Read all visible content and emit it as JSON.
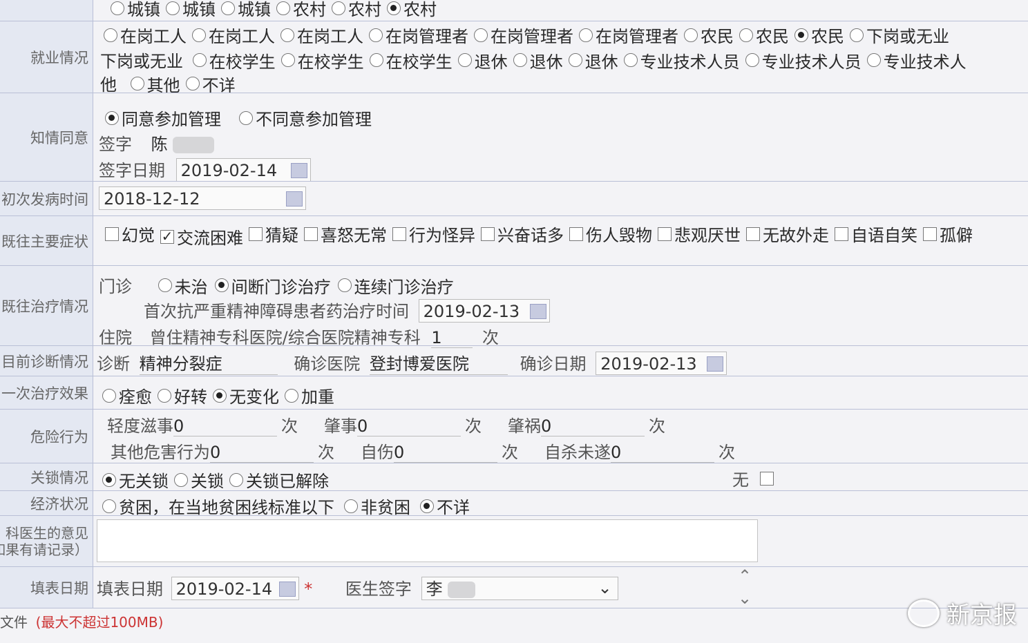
{
  "residence": {
    "options": [
      {
        "label": "城镇",
        "checked": false
      },
      {
        "label": "城镇",
        "checked": false
      },
      {
        "label": "城镇",
        "checked": false
      },
      {
        "label": "农村",
        "checked": false
      },
      {
        "label": "农村",
        "checked": false
      },
      {
        "label": "农村",
        "checked": true
      }
    ]
  },
  "employment": {
    "label": "就业情况",
    "line1": [
      {
        "label": "在岗工人",
        "checked": false
      },
      {
        "label": "在岗工人",
        "checked": false
      },
      {
        "label": "在岗工人",
        "checked": false
      },
      {
        "label": "在岗管理者",
        "checked": false
      },
      {
        "label": "在岗管理者",
        "checked": false
      },
      {
        "label": "在岗管理者",
        "checked": false
      },
      {
        "label": "农民",
        "checked": false
      },
      {
        "label": "农民",
        "checked": false
      },
      {
        "label": "农民",
        "checked": true
      },
      {
        "label": "下岗或无业",
        "checked": false
      }
    ],
    "line2_prefix": "下岗或无业",
    "line2": [
      {
        "label": "在校学生",
        "checked": false
      },
      {
        "label": "在校学生",
        "checked": false
      },
      {
        "label": "在校学生",
        "checked": false
      },
      {
        "label": "退休",
        "checked": false
      },
      {
        "label": "退休",
        "checked": false
      },
      {
        "label": "退休",
        "checked": false
      },
      {
        "label": "专业技术人员",
        "checked": false
      },
      {
        "label": "专业技术人员",
        "checked": false
      },
      {
        "label": "专业技术人",
        "checked": false
      }
    ],
    "line3_prefix": "他",
    "line3": [
      {
        "label": "其他",
        "checked": false
      },
      {
        "label": "不详",
        "checked": false
      }
    ]
  },
  "consent": {
    "label": "知情同意",
    "options": [
      {
        "label": "同意参加管理",
        "checked": true
      },
      {
        "label": "不同意参加管理",
        "checked": false
      }
    ],
    "sign_label": "签字",
    "sign_value": "陈",
    "date_label": "签字日期",
    "date_value": "2019-02-14"
  },
  "onset": {
    "label": "初次发病时间",
    "value": "2018-12-12"
  },
  "symptoms": {
    "label": "既往主要症状",
    "items": [
      {
        "label": "幻觉",
        "checked": false
      },
      {
        "label": "交流困难",
        "checked": true
      },
      {
        "label": "猜疑",
        "checked": false
      },
      {
        "label": "喜怒无常",
        "checked": false
      },
      {
        "label": "行为怪异",
        "checked": false
      },
      {
        "label": "兴奋话多",
        "checked": false
      },
      {
        "label": "伤人毁物",
        "checked": false
      },
      {
        "label": "悲观厌世",
        "checked": false
      },
      {
        "label": "无故外走",
        "checked": false
      },
      {
        "label": "自语自笑",
        "checked": false
      },
      {
        "label": "孤僻",
        "checked": false
      }
    ]
  },
  "treatment": {
    "label": "既往治疗情况",
    "outpatient_label": "门诊",
    "outpatient": [
      {
        "label": "未治",
        "checked": false
      },
      {
        "label": "间断门诊治疗",
        "checked": true
      },
      {
        "label": "连续门诊治疗",
        "checked": false
      }
    ],
    "first_drug_label": "首次抗严重精神障碍患者药治疗时间",
    "first_drug_date": "2019-02-13",
    "inpatient_label": "住院",
    "inpatient_text": "曾住精神专科医院/综合医院精神专科",
    "inpatient_count": "1",
    "times_unit": "次"
  },
  "diagnosis": {
    "label": "目前诊断情况",
    "diag_label": "诊断",
    "diag_value": "精神分裂症",
    "hospital_label": "确诊医院",
    "hospital_value": "登封博爱医院",
    "date_label": "确诊日期",
    "date_value": "2019-02-13"
  },
  "effect": {
    "label": "一次治疗效果",
    "options": [
      {
        "label": "痊愈",
        "checked": false
      },
      {
        "label": "好转",
        "checked": false
      },
      {
        "label": "无变化",
        "checked": true
      },
      {
        "label": "加重",
        "checked": false
      }
    ]
  },
  "danger": {
    "label": "危险行为",
    "items": [
      {
        "label": "轻度滋事",
        "value": "0"
      },
      {
        "label": "肇事",
        "value": "0"
      },
      {
        "label": "肇祸",
        "value": "0"
      },
      {
        "label": "其他危害行为",
        "value": "0"
      },
      {
        "label": "自伤",
        "value": "0"
      },
      {
        "label": "自杀未遂",
        "value": "0"
      }
    ],
    "unit": "次",
    "none_label": "无"
  },
  "lock": {
    "label": "关锁情况",
    "options": [
      {
        "label": "无关锁",
        "checked": true
      },
      {
        "label": "关锁",
        "checked": false
      },
      {
        "label": "关锁已解除",
        "checked": false
      }
    ]
  },
  "economy": {
    "label": "经济状况",
    "options": [
      {
        "label": "贫困，在当地贫困线标准以下",
        "checked": false
      },
      {
        "label": "非贫困",
        "checked": false
      },
      {
        "label": "不详",
        "checked": true
      }
    ]
  },
  "doctor_opinion": {
    "label_line1": "科医生的意见",
    "label_line2": "如果有请记录）"
  },
  "fill": {
    "label": "填表日期",
    "date_label": "填表日期",
    "date_value": "2019-02-14",
    "required_mark": "*",
    "doctor_label": "医生签字",
    "doctor_value": "李"
  },
  "file": {
    "label": "文件",
    "note": "(最大不超过100MB)"
  },
  "watermark": "新京报"
}
